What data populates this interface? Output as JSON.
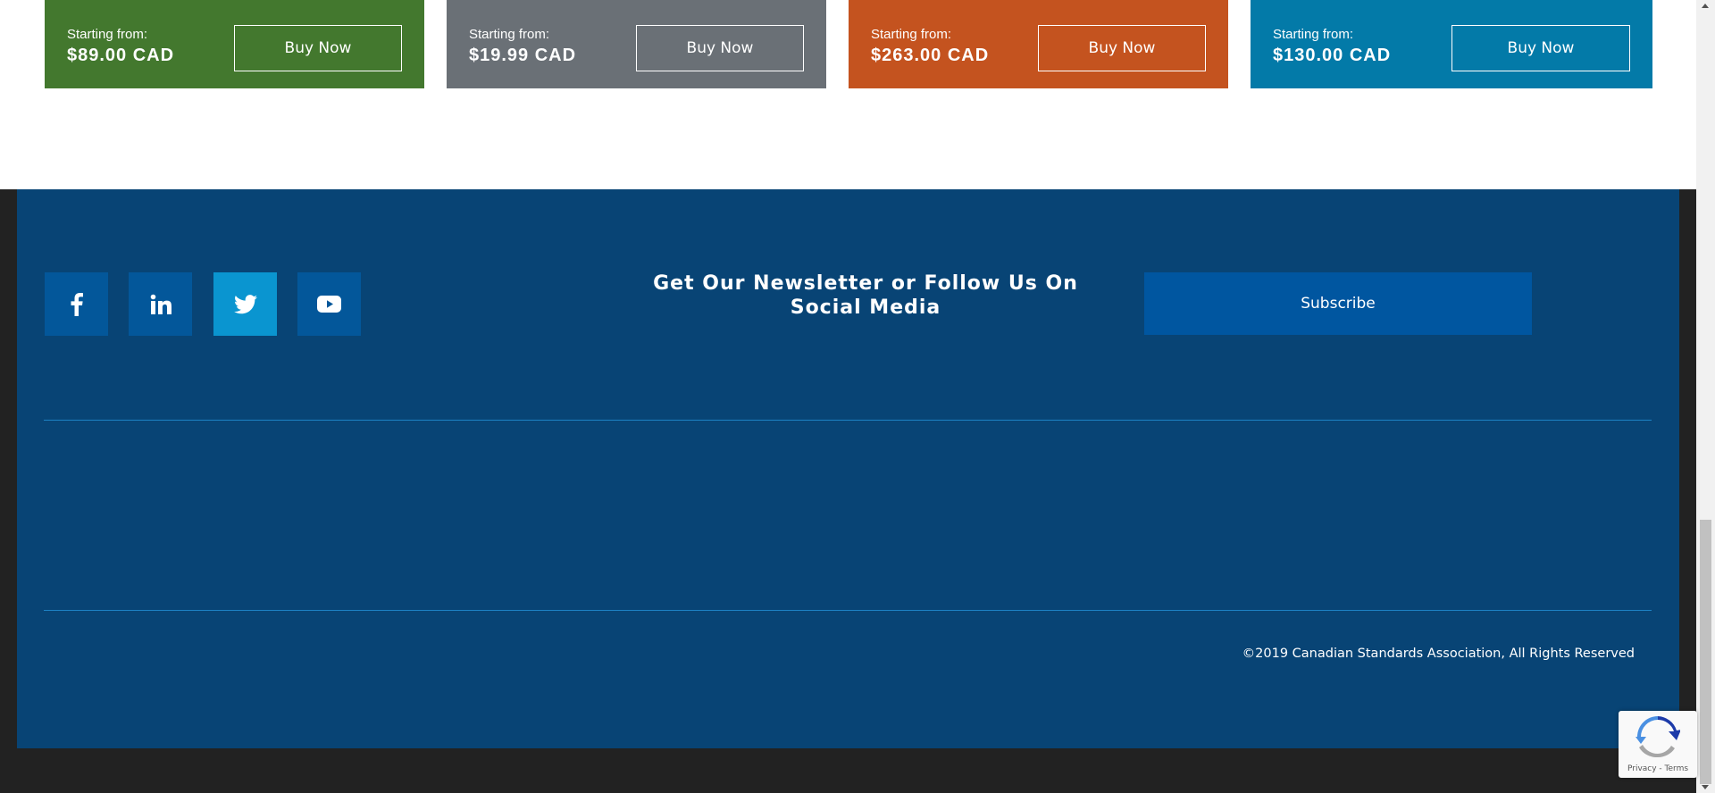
{
  "pricing": {
    "cards": [
      {
        "starting_label": "Starting from:",
        "price": "$89.00 CAD",
        "button_label": "Buy Now",
        "color": "#43782e"
      },
      {
        "starting_label": "Starting from:",
        "price": "$19.99 CAD",
        "button_label": "Buy Now",
        "color": "#6a7076"
      },
      {
        "starting_label": "Starting from:",
        "price": "$263.00 CAD",
        "button_label": "Buy Now",
        "color": "#c4531f"
      },
      {
        "starting_label": "Starting from:",
        "price": "$130.00 CAD",
        "button_label": "Buy Now",
        "color": "#037aa8"
      }
    ]
  },
  "footer": {
    "background_color": "#084475",
    "social": [
      {
        "icon": "facebook-icon",
        "color": "#03579a"
      },
      {
        "icon": "linkedin-icon",
        "color": "#03579a"
      },
      {
        "icon": "twitter-icon",
        "color": "#0a95d0"
      },
      {
        "icon": "youtube-icon",
        "color": "#03579a"
      }
    ],
    "newsletter_title": "Get Our Newsletter or Follow Us On Social Media",
    "subscribe_label": "Subscribe",
    "copyright": "©2019 Canadian Standards Association, All Rights Reserved"
  },
  "recaptcha": {
    "terms": "Privacy - Terms"
  }
}
